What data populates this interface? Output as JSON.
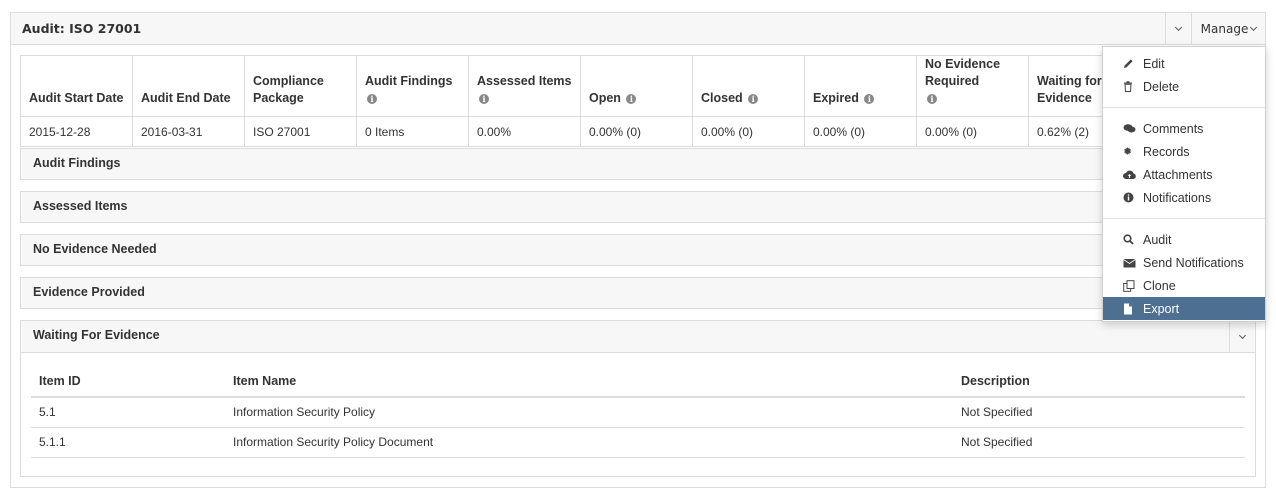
{
  "panel": {
    "title": "Audit: ISO 27001",
    "manage_label": "Manage"
  },
  "summary": {
    "headers": [
      {
        "label": "Audit Start Date",
        "info": false
      },
      {
        "label": "Audit End Date",
        "info": false
      },
      {
        "label": "Compliance Package",
        "info": false
      },
      {
        "label": "Audit Findings",
        "info": true
      },
      {
        "label": "Assessed Items",
        "info": true
      },
      {
        "label": "Open",
        "info": true
      },
      {
        "label": "Closed",
        "info": true
      },
      {
        "label": "Expired",
        "info": true
      },
      {
        "label": "No Evidence Required",
        "info": true
      },
      {
        "label": "Waiting for Evidence",
        "info": true
      }
    ],
    "row": [
      "2015-12-28",
      "2016-03-31",
      "ISO 27001",
      "0 Items",
      "0.00%",
      "0.00% (0)",
      "0.00% (0)",
      "0.00% (0)",
      "0.00% (0)",
      "0.62% (2)"
    ]
  },
  "sections": {
    "audit_findings": "Audit Findings",
    "assessed_items": "Assessed Items",
    "no_evidence_needed": "No Evidence Needed",
    "evidence_provided": "Evidence Provided",
    "waiting_for_evidence": "Waiting For Evidence"
  },
  "items_table": {
    "headers": [
      "Item ID",
      "Item Name",
      "Description"
    ],
    "rows": [
      [
        "5.1",
        "Information Security Policy",
        "Not Specified"
      ],
      [
        "5.1.1",
        "Information Security Policy Document",
        "Not Specified"
      ]
    ]
  },
  "manage_menu": {
    "edit": {
      "label": "Edit",
      "icon": "pencil-icon"
    },
    "delete": {
      "label": "Delete",
      "icon": "trash-icon"
    },
    "comments": {
      "label": "Comments",
      "icon": "comments-icon"
    },
    "records": {
      "label": "Records",
      "icon": "gear-icon"
    },
    "attachments": {
      "label": "Attachments",
      "icon": "cloud-upload-icon"
    },
    "notifications": {
      "label": "Notifications",
      "icon": "info-circle-icon"
    },
    "audit": {
      "label": "Audit",
      "icon": "search-icon"
    },
    "send_notifications": {
      "label": "Send Notifications",
      "icon": "envelope-icon"
    },
    "clone": {
      "label": "Clone",
      "icon": "clone-icon"
    },
    "export": {
      "label": "Export",
      "icon": "file-icon"
    },
    "active_color": "#4d6f91"
  }
}
